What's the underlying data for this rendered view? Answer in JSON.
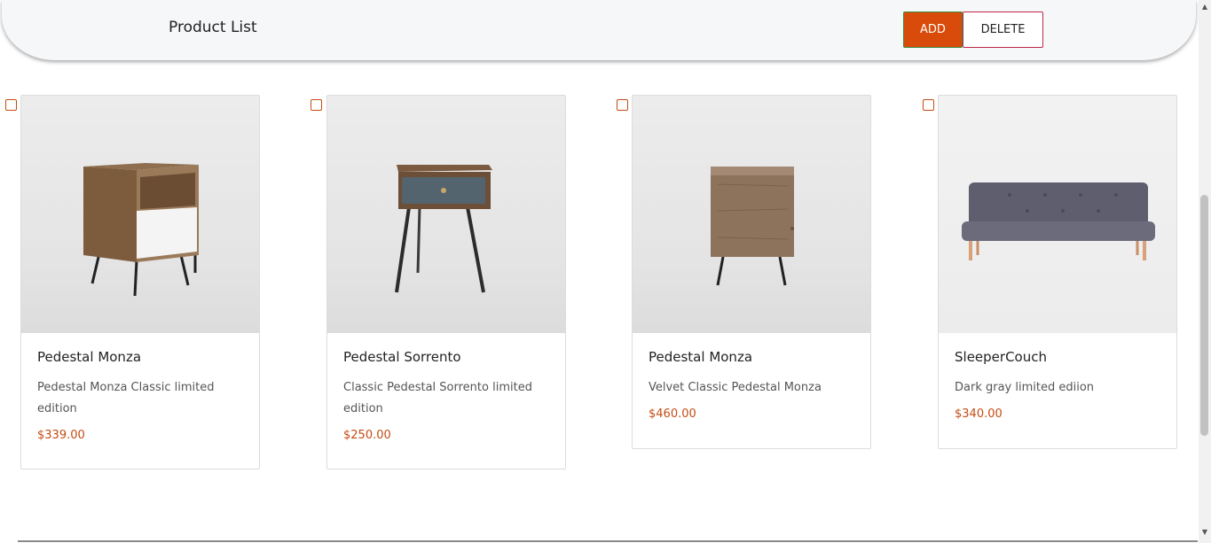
{
  "header": {
    "title": "Product List",
    "add_label": "ADD",
    "delete_label": "DELETE"
  },
  "colors": {
    "accent": "#d84b0a",
    "price": "#c44c12",
    "delete_border": "#c0284c"
  },
  "products": [
    {
      "name": "Pedestal Monza",
      "description": "Pedestal Monza Classic limited edition",
      "price": "$339.00",
      "image": "nightstand-with-drawer-image",
      "checked": false
    },
    {
      "name": "Pedestal Sorrento",
      "description": "Classic Pedestal Sorrento limited edition",
      "price": "$250.00",
      "image": "side-table-with-drawer-image",
      "checked": false
    },
    {
      "name": "Pedestal Monza",
      "description": "Velvet Classic Pedestal Monza",
      "price": "$460.00",
      "image": "cabinet-nightstand-image",
      "checked": false
    },
    {
      "name": "SleeperCouch",
      "description": "Dark gray limited ediion",
      "price": "$340.00",
      "image": "gray-sofa-image",
      "checked": false
    }
  ]
}
